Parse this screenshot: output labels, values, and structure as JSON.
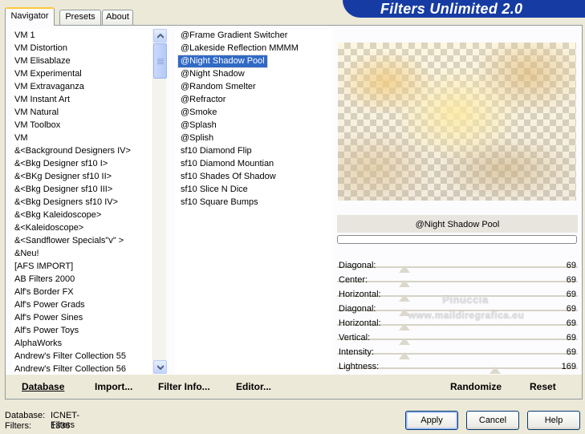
{
  "banner": {
    "title": "Filters Unlimited 2.0"
  },
  "tabs": [
    {
      "label": "Navigator"
    },
    {
      "label": "Presets"
    },
    {
      "label": "About"
    }
  ],
  "categories": [
    "VM 1",
    "VM Distortion",
    "VM Elisablaze",
    "VM Experimental",
    "VM Extravaganza",
    "VM Instant Art",
    "VM Natural",
    "VM Toolbox",
    "VM",
    "&<Background Designers IV>",
    "&<Bkg Designer sf10 I>",
    "&<BKg Designer sf10 II>",
    "&<Bkg Designer sf10 III>",
    "&<Bkg Designers sf10 IV>",
    "&<Bkg Kaleidoscope>",
    "&<Kaleidoscope>",
    "&<Sandflower Specials\"v\" >",
    "&Neu!",
    "[AFS IMPORT]",
    "AB Filters 2000",
    "Alf's Border FX",
    "Alf's Power Grads",
    "Alf's Power Sines",
    "Alf's Power Toys",
    "AlphaWorks",
    "Andrew's Filter Collection 55",
    "Andrew's Filter Collection 56"
  ],
  "filters": [
    "@Frame Gradient Switcher",
    "@Lakeside Reflection MMMM",
    "@Night Shadow Pool",
    "@Night Shadow",
    "@Random Smelter",
    "@Refractor",
    "@Smoke",
    "@Splash",
    "@Splish",
    "sf10 Diamond Flip",
    "sf10 Diamond Mountian",
    "sf10 Shades Of Shadow",
    "sf10 Slice N Dice",
    "sf10 Square Bumps"
  ],
  "selected_filter": "@Night Shadow Pool",
  "parameters": [
    {
      "label": "Diagonal:",
      "value": "69",
      "level": 69
    },
    {
      "label": "Center:",
      "value": "69",
      "level": 69
    },
    {
      "label": "Horizontal:",
      "value": "69",
      "level": 69
    },
    {
      "label": "Diagonal:",
      "value": "69",
      "level": 69
    },
    {
      "label": "Horizontal:",
      "value": "69",
      "level": 69
    },
    {
      "label": "Vertical:",
      "value": "69",
      "level": 69
    },
    {
      "label": "Intensity:",
      "value": "69",
      "level": 69
    },
    {
      "label": "Lightness:",
      "value": "169",
      "level": 169
    }
  ],
  "watermark": {
    "line1": "Pinuccia",
    "line2": "www.maildiregrafica.eu"
  },
  "bottom_links": {
    "database": "Database",
    "import": "Import...",
    "filter_info": "Filter Info...",
    "editor": "Editor...",
    "randomize": "Randomize",
    "reset": "Reset"
  },
  "status": {
    "database_label": "Database:",
    "database_value": "ICNET-Filters",
    "filters_label": "Filters:",
    "filters_value": "1336"
  },
  "buttons": {
    "apply": "Apply",
    "cancel": "Cancel",
    "help": "Help"
  },
  "colors": {
    "banner": "#163ca4",
    "selection": "#316ac5",
    "tab_accent": "#ffc83c"
  }
}
